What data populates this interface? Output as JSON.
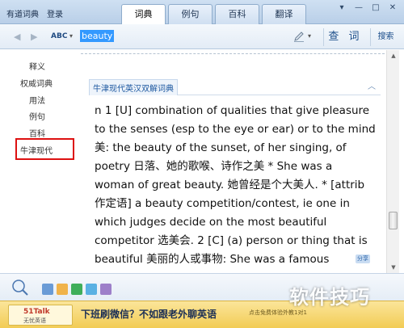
{
  "window": {
    "app_title": "有道词典",
    "login_label": "登录",
    "tabs": [
      {
        "label": "词典",
        "active": true
      },
      {
        "label": "例句",
        "active": false
      },
      {
        "label": "百科",
        "active": false
      },
      {
        "label": "翻译",
        "active": false
      }
    ],
    "controls": {
      "menu": "▾",
      "minimize": "—",
      "maximize": "□",
      "close": "✕"
    }
  },
  "search": {
    "back_icon": "back-arrow-icon",
    "forward_icon": "forward-arrow-icon",
    "input_mode_label": "ABC",
    "value": "beauty",
    "query_label": "查 词",
    "search_web_label": "搜索"
  },
  "sidebar": {
    "items": [
      "释义",
      "权威词典",
      "用法",
      "例句",
      "百科",
      "牛津现代"
    ],
    "selected": "牛津现代"
  },
  "content": {
    "section_title": "牛津现代英汉双解词典",
    "lines": [
      "n 1 [U] combination of qualities that give pleasure",
      "to the senses (esp to the eye or ear) or to the mind",
      "美: the beauty of the sunset, of her singing, of",
      "poetry 日落、她的歌喉、诗作之美 * She was a",
      "woman of great beauty. 她曾经是个大美人. * [attrib",
      "作定语] a beauty competition/contest, ie one in",
      "which judges decide on the most beautiful",
      "competitor 选美会. 2 [C] (a) person or thing that is",
      "beautiful 美丽的人或事物: She was a famous"
    ],
    "share_label": "分享"
  },
  "ad": {
    "logo_line1": "51Talk",
    "logo_line2": "无忧英语",
    "headline": "下班刷微信？不如跟老外聊英语",
    "small_text": "点击免费体验外教1对1"
  },
  "watermark": "软件技巧",
  "colors": {
    "accent": "#3399ff",
    "highlight_border": "#dd1111",
    "link_blue": "#1d58a0",
    "ad_bg": "#f2cc55"
  }
}
